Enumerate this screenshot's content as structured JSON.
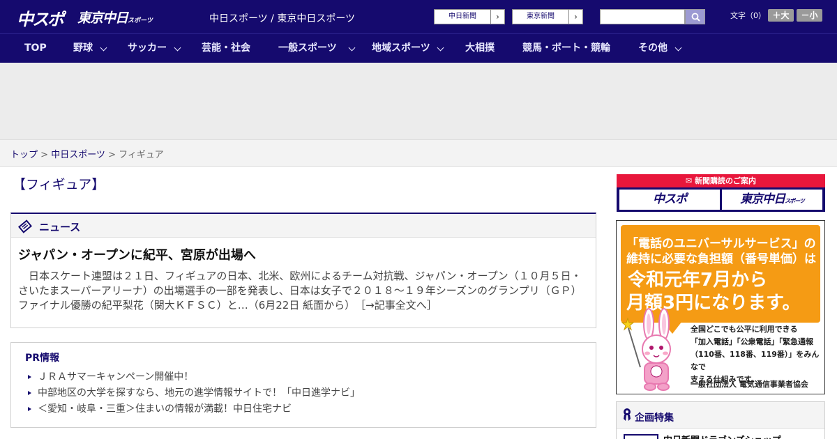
{
  "header": {
    "logo_main": "中スポ",
    "logo_tokyo": "東京中日",
    "logo_tokyo_small": "スポーツ",
    "site_links": "中日スポーツ / 東京中日スポーツ",
    "ext_links": [
      "中日新聞",
      "東京新聞"
    ],
    "search": {
      "value": "",
      "placeholder": ""
    },
    "font_size_label": "文字（0）",
    "font_larger": "＋大",
    "font_smaller": "－小"
  },
  "nav": {
    "items": [
      {
        "label": "TOP",
        "dropdown": false
      },
      {
        "label": "野球",
        "dropdown": true
      },
      {
        "label": "サッカー",
        "dropdown": true
      },
      {
        "label": "芸能・社会",
        "dropdown": false
      },
      {
        "label": "一般スポーツ",
        "dropdown": true
      },
      {
        "label": "地域スポーツ",
        "dropdown": true
      },
      {
        "label": "大相撲",
        "dropdown": false
      },
      {
        "label": "競馬・ボート・競輪",
        "dropdown": false
      },
      {
        "label": "その他",
        "dropdown": true
      }
    ]
  },
  "breadcrumb": {
    "home": "トップ",
    "sep": " > ",
    "section": "中日スポーツ",
    "current": "フィギュア"
  },
  "page": {
    "title": "【フィギュア】"
  },
  "news": {
    "label": "ニュース",
    "article_title": "ジャパン・オープンに紀平、宮原が出場へ",
    "article_body": "日本スケート連盟は２１日、フィギュアの日本、北米、欧州によるチーム対抗戦、ジャパン・オープン（１０月５日・さいたまスーパーアリーナ）の出場選手の一部を発表し、日本は女子で２０１８～１９年シーズンのグランプリ（ＧＰ）ファイナル優勝の紀平梨花（関大ＫＦＳＣ）と…（6月22日 紙面から）",
    "read_more": "［→記事全文へ］"
  },
  "pr": {
    "title": "PR情報",
    "items": [
      "ＪＲＡサマーキャンペーン開催中！",
      "中部地区の大学を探すなら、地元の進学情報サイトで！「中日進学ナビ」",
      "＜愛知・岐阜・三重＞住まいの情報が満載！中日住宅ナビ"
    ]
  },
  "sidebar": {
    "subscription": {
      "heading": "新聞購読のご案内",
      "logo_chuspo": "中スポ",
      "logo_tokyo": "東京中日",
      "logo_tokyo_small": "スポーツ"
    },
    "banner": {
      "line1": "「電話のユニバーサルサービス」の",
      "line2": "維持に必要な負担額（番号単価）は",
      "line3": "令和元年7月から",
      "line4": "月額3円になります。",
      "text": [
        "全国どこでも公平に利用できる",
        "「加入電話」「公衆電話」「緊急通報",
        "（110番、118番、119番）」をみんなで",
        "支える仕組みです。"
      ],
      "org": "一般社団法人 電気通信事業者協会"
    },
    "feature": {
      "title": "企画特集",
      "item": "中日新聞ドラゴンズショップ"
    }
  },
  "colors": {
    "brand_navy": "#150a6e",
    "accent_red": "#e8173c",
    "banner_orange": "#f59b14"
  }
}
